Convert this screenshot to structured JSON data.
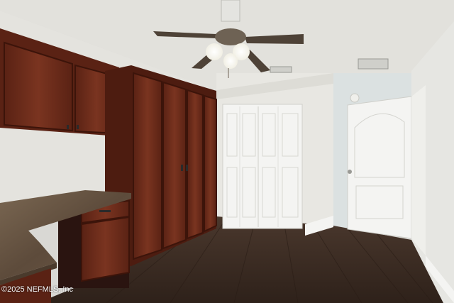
{
  "photo": {
    "watermark": "©2025 NEFMLS, Inc"
  },
  "colors": {
    "ceiling": "#e2e1dc",
    "wall_left": "#e3e2dd",
    "wall_back": "#e6e5e0",
    "wall_right": "#dbe0e0",
    "cabinet_wood": "#6a2a1a",
    "cabinet_dark": "#4d1c10",
    "countertop_granite": "#6c5a48",
    "floor_wood": "#3f2f26",
    "door_white": "#f4f4f2",
    "fan_bronze": "#4e4237"
  }
}
